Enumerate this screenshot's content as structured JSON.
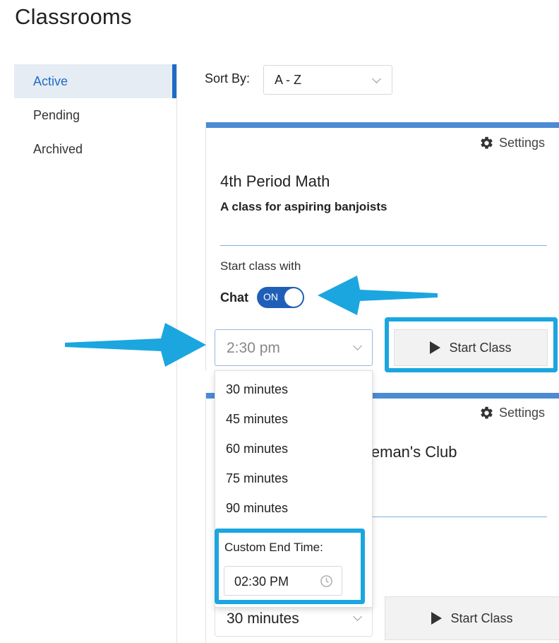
{
  "page": {
    "title": "Classrooms"
  },
  "sidebar": {
    "items": [
      {
        "label": "Active"
      },
      {
        "label": "Pending"
      },
      {
        "label": "Archived"
      }
    ]
  },
  "sort": {
    "label": "Sort By:",
    "value": "A - Z"
  },
  "cards": [
    {
      "settings_label": "Settings",
      "title": "4th Period Math",
      "subtitle": "A class for aspiring banjoists",
      "start_with_label": "Start class with",
      "chat_label": "Chat",
      "chat_toggle_text": "ON",
      "time_value": "2:30 pm",
      "start_label": "Start Class"
    },
    {
      "settings_label": "Settings",
      "title_fragment": "leman's Club",
      "time_value": "30 minutes",
      "start_label": "Start Class"
    }
  ],
  "dropdown": {
    "options": [
      "30 minutes",
      "45 minutes",
      "60 minutes",
      "75 minutes",
      "90 minutes"
    ],
    "custom_label": "Custom End Time:",
    "custom_value": "02:30 PM"
  },
  "colors": {
    "accent": "#1f6bc4",
    "card_top": "#4a8bd4",
    "highlight": "#1ba6df",
    "toggle": "#1f5fb8"
  }
}
